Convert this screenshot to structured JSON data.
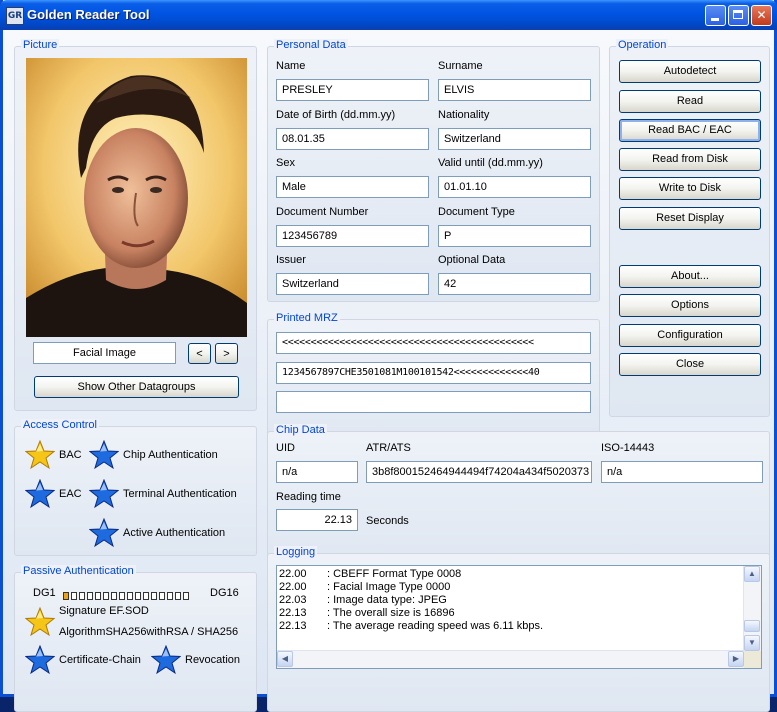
{
  "window": {
    "title": "Golden Reader Tool",
    "icon_text": "GR"
  },
  "picture": {
    "title": "Picture",
    "caption": "Facial Image",
    "prev_label": "<",
    "next_label": ">",
    "show_other_label": "Show Other Datagroups"
  },
  "personal": {
    "title": "Personal Data",
    "fields": [
      {
        "label": "Name",
        "value": "PRESLEY"
      },
      {
        "label": "Surname",
        "value": "ELVIS"
      },
      {
        "label": "Date of Birth (dd.mm.yy)",
        "value": "08.01.35"
      },
      {
        "label": "Nationality",
        "value": "Switzerland"
      },
      {
        "label": "Sex",
        "value": "Male"
      },
      {
        "label": "Valid until (dd.mm.yy)",
        "value": "01.01.10"
      },
      {
        "label": "Document Number",
        "value": "123456789"
      },
      {
        "label": "Document Type",
        "value": "P"
      },
      {
        "label": "Issuer",
        "value": "Switzerland"
      },
      {
        "label": "Optional Data",
        "value": "42"
      }
    ]
  },
  "mrz": {
    "title": "Printed MRZ",
    "line1": "<<<<<<<<<<<<<<<<<<<<<<<<<<<<<<<<<<<<<<<<<<<<",
    "line2": "1234567897CHE3501081M100101542<<<<<<<<<<<<<40",
    "line3": ""
  },
  "operation": {
    "title": "Operation",
    "buttons": [
      "Autodetect",
      "Read",
      "Read BAC / EAC",
      "Read from Disk",
      "Write to Disk",
      "Reset Display",
      "About...",
      "Options",
      "Configuration",
      "Close"
    ]
  },
  "access": {
    "title": "Access Control",
    "bac": "BAC",
    "eac": "EAC",
    "chip_auth": "Chip Authentication",
    "terminal_auth": "Terminal Authentication",
    "active_auth": "Active Authentication"
  },
  "chip": {
    "title": "Chip Data",
    "uid_label": "UID",
    "uid_value": "n/a",
    "atr_label": "ATR/ATS",
    "atr_value": "3b8f800152464944494f74204a434f5020373",
    "iso_label": "ISO-14443",
    "iso_value": "n/a",
    "reading_label": "Reading time",
    "reading_value": "22.13",
    "reading_unit": "Seconds"
  },
  "passive": {
    "title": "Passive Authentication",
    "dg1": "DG1",
    "dg16": "DG16",
    "dg_status": [
      true,
      false,
      false,
      false,
      false,
      false,
      false,
      false,
      false,
      false,
      false,
      false,
      false,
      false,
      false,
      false
    ],
    "signature": "Signature EF.SOD",
    "algorithm": "AlgorithmSHA256withRSA / SHA256",
    "cert_chain": "Certificate-Chain",
    "revocation": "Revocation"
  },
  "logging": {
    "title": "Logging",
    "lines": [
      {
        "t": "22.00",
        "m": ": CBEFF Format Type 0008"
      },
      {
        "t": "22.00",
        "m": ": Facial Image Type 0000"
      },
      {
        "t": "22.03",
        "m": ": Image data type: JPEG"
      },
      {
        "t": "22.13",
        "m": ": The overall size is 16896"
      },
      {
        "t": "22.13",
        "m": ": The average reading speed was 6.11 kbps."
      }
    ]
  },
  "colors": {
    "accent": "#0046d5",
    "star_gold": "#f5c518",
    "star_blue": "#1e6be0"
  }
}
